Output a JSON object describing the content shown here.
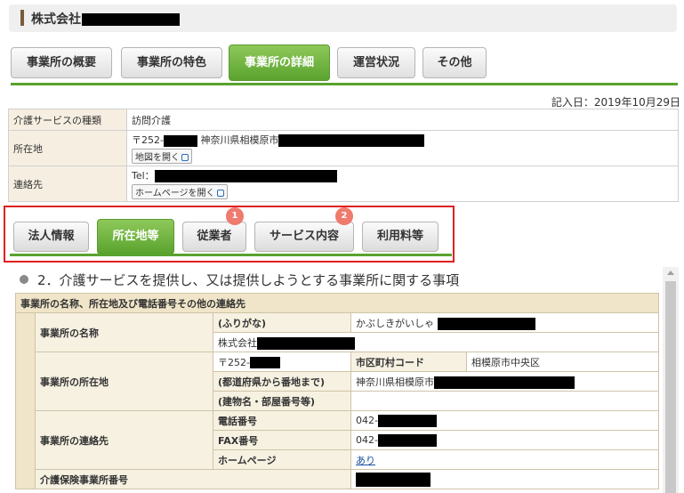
{
  "header": {
    "company_name": "株式会社"
  },
  "top_tabs": [
    "事業所の概要",
    "事業所の特色",
    "事業所の詳細",
    "運営状況",
    "その他"
  ],
  "record_date": "記入日：2019年10月29日",
  "info": {
    "service_type_label": "介護サービスの種類",
    "service_type_value": "訪問介護",
    "address_label": "所在地",
    "postal_prefix": "〒252-",
    "address_prefix": "神奈川県相模原市",
    "map_button": "地図を開く",
    "contact_label": "連絡先",
    "tel_prefix": "Tel：",
    "homepage_button": "ホームページを開く"
  },
  "sub_tabs": [
    {
      "label": "法人情報",
      "badge": ""
    },
    {
      "label": "所在地等",
      "badge": ""
    },
    {
      "label": "従業者",
      "badge": "1"
    },
    {
      "label": "サービス内容",
      "badge": "2"
    },
    {
      "label": "利用料等",
      "badge": ""
    }
  ],
  "section_title": "2．介護サービスを提供し、又は提供しようとする事業所に関する事項",
  "detail": {
    "header": "事業所の名称、所在地及び電話番号その他の連絡先",
    "name_label": "事業所の名称",
    "furigana_label": "(ふりがな)",
    "furigana_value": "かぶしきがいしゃ",
    "name_value": "株式会社",
    "location_label": "事業所の所在地",
    "postal": "〒252-",
    "city_code_label": "市区町村コード",
    "city_code_value": "相模原市中央区",
    "pref_label": "(都道府県から番地まで)",
    "pref_value": "神奈川県相模原市",
    "building_label": "(建物名・部屋番号等)",
    "building_value": "",
    "contact_label": "事業所の連絡先",
    "phone_label": "電話番号",
    "phone_value": "042-",
    "fax_label": "FAX番号",
    "fax_value": "042-",
    "homepage_label": "ホームページ",
    "homepage_value": "あり",
    "insurance_label": "介護保険事業所番号"
  }
}
